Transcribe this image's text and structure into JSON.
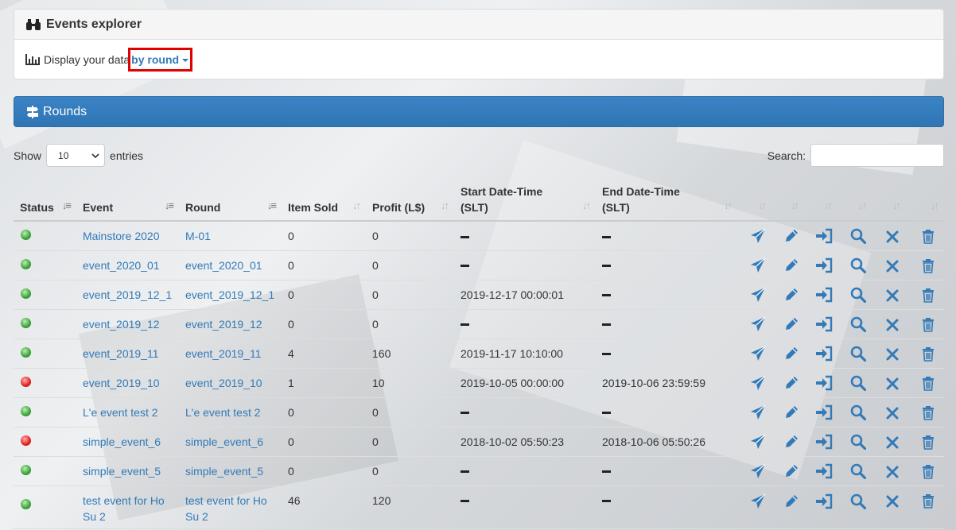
{
  "explorer": {
    "title": "Events explorer",
    "display_prefix": "Display your data",
    "display_option": "by round"
  },
  "rounds_panel": {
    "title": "Rounds"
  },
  "length_menu": {
    "show_label": "Show",
    "value": "10",
    "entries_label": "entries"
  },
  "search": {
    "label": "Search:",
    "value": ""
  },
  "columns": {
    "status": "Status",
    "event": "Event",
    "round": "Round",
    "item_sold": "Item Sold",
    "profit": "Profit (L$)",
    "start_line1": "Start Date-Time",
    "start_line2": "(SLT)",
    "end_line1": "End Date-Time",
    "end_line2": "(SLT)"
  },
  "colors": {
    "accent": "#337ab7",
    "panel_header": "#2f75b4",
    "status_active": "#3ca03a",
    "status_ended": "#e02020",
    "highlight_box": "#e00000"
  },
  "rows": [
    {
      "status": "green",
      "event": "Mainstore 2020",
      "round": "M-01",
      "sold": "0",
      "profit": "0",
      "start": "",
      "end": ""
    },
    {
      "status": "green",
      "event": "event_2020_01",
      "round": "event_2020_01",
      "sold": "0",
      "profit": "0",
      "start": "",
      "end": ""
    },
    {
      "status": "green",
      "event": "event_2019_12_1",
      "round": "event_2019_12_1",
      "sold": "0",
      "profit": "0",
      "start": "2019-12-17 00:00:01",
      "end": ""
    },
    {
      "status": "green",
      "event": "event_2019_12",
      "round": "event_2019_12",
      "sold": "0",
      "profit": "0",
      "start": "",
      "end": ""
    },
    {
      "status": "green",
      "event": "event_2019_11",
      "round": "event_2019_11",
      "sold": "4",
      "profit": "160",
      "start": "2019-11-17 10:10:00",
      "end": ""
    },
    {
      "status": "red",
      "event": "event_2019_10",
      "round": "event_2019_10",
      "sold": "1",
      "profit": "10",
      "start": "2019-10-05 00:00:00",
      "end": "2019-10-06 23:59:59"
    },
    {
      "status": "green",
      "event": "L'e event test 2",
      "round": "L'e event test 2",
      "sold": "0",
      "profit": "0",
      "start": "",
      "end": ""
    },
    {
      "status": "red",
      "event": "simple_event_6",
      "round": "simple_event_6",
      "sold": "0",
      "profit": "0",
      "start": "2018-10-02 05:50:23",
      "end": "2018-10-06 05:50:26"
    },
    {
      "status": "green",
      "event": "simple_event_5",
      "round": "simple_event_5",
      "sold": "0",
      "profit": "0",
      "start": "",
      "end": ""
    },
    {
      "status": "green",
      "event": "test event for Ho Su 2",
      "round": "test event for Ho Su 2",
      "sold": "46",
      "profit": "120",
      "start": "",
      "end": ""
    }
  ],
  "row_actions": [
    "send-icon",
    "edit-icon",
    "sign-in-icon",
    "search-icon",
    "delete-icon",
    "trash-icon"
  ]
}
